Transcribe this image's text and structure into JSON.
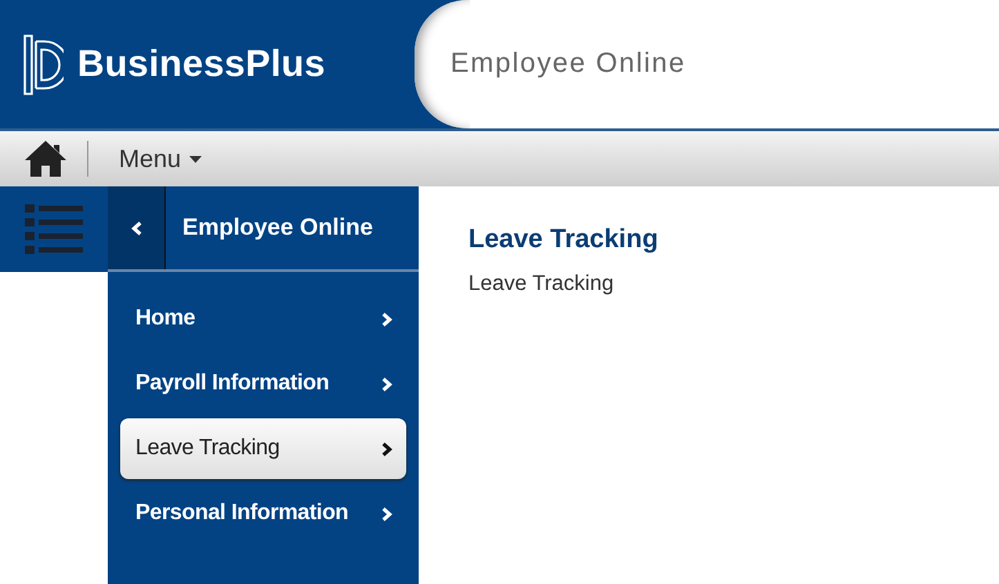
{
  "header": {
    "brand": "BusinessPlus",
    "title": "Employee Online"
  },
  "toolbar": {
    "menu": "Menu"
  },
  "sidebar": {
    "title": "Employee Online",
    "items": [
      {
        "label": "Home",
        "selected": false
      },
      {
        "label": "Payroll Information",
        "selected": false
      },
      {
        "label": "Leave Tracking",
        "selected": true
      },
      {
        "label": "Personal Information",
        "selected": false
      }
    ]
  },
  "content": {
    "heading": "Leave Tracking",
    "text": "Leave Tracking"
  }
}
